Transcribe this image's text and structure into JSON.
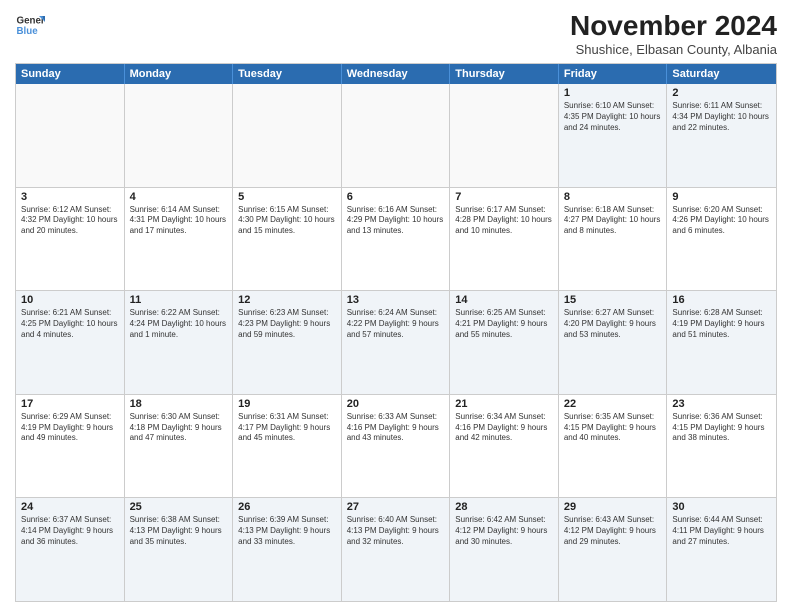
{
  "header": {
    "logo_line1": "General",
    "logo_line2": "Blue",
    "month_title": "November 2024",
    "subtitle": "Shushice, Elbasan County, Albania"
  },
  "days_of_week": [
    "Sunday",
    "Monday",
    "Tuesday",
    "Wednesday",
    "Thursday",
    "Friday",
    "Saturday"
  ],
  "weeks": [
    [
      {
        "day": "",
        "info": "",
        "empty": true
      },
      {
        "day": "",
        "info": "",
        "empty": true
      },
      {
        "day": "",
        "info": "",
        "empty": true
      },
      {
        "day": "",
        "info": "",
        "empty": true
      },
      {
        "day": "",
        "info": "",
        "empty": true
      },
      {
        "day": "1",
        "info": "Sunrise: 6:10 AM\nSunset: 4:35 PM\nDaylight: 10 hours and 24 minutes."
      },
      {
        "day": "2",
        "info": "Sunrise: 6:11 AM\nSunset: 4:34 PM\nDaylight: 10 hours and 22 minutes."
      }
    ],
    [
      {
        "day": "3",
        "info": "Sunrise: 6:12 AM\nSunset: 4:32 PM\nDaylight: 10 hours and 20 minutes."
      },
      {
        "day": "4",
        "info": "Sunrise: 6:14 AM\nSunset: 4:31 PM\nDaylight: 10 hours and 17 minutes."
      },
      {
        "day": "5",
        "info": "Sunrise: 6:15 AM\nSunset: 4:30 PM\nDaylight: 10 hours and 15 minutes."
      },
      {
        "day": "6",
        "info": "Sunrise: 6:16 AM\nSunset: 4:29 PM\nDaylight: 10 hours and 13 minutes."
      },
      {
        "day": "7",
        "info": "Sunrise: 6:17 AM\nSunset: 4:28 PM\nDaylight: 10 hours and 10 minutes."
      },
      {
        "day": "8",
        "info": "Sunrise: 6:18 AM\nSunset: 4:27 PM\nDaylight: 10 hours and 8 minutes."
      },
      {
        "day": "9",
        "info": "Sunrise: 6:20 AM\nSunset: 4:26 PM\nDaylight: 10 hours and 6 minutes."
      }
    ],
    [
      {
        "day": "10",
        "info": "Sunrise: 6:21 AM\nSunset: 4:25 PM\nDaylight: 10 hours and 4 minutes."
      },
      {
        "day": "11",
        "info": "Sunrise: 6:22 AM\nSunset: 4:24 PM\nDaylight: 10 hours and 1 minute."
      },
      {
        "day": "12",
        "info": "Sunrise: 6:23 AM\nSunset: 4:23 PM\nDaylight: 9 hours and 59 minutes."
      },
      {
        "day": "13",
        "info": "Sunrise: 6:24 AM\nSunset: 4:22 PM\nDaylight: 9 hours and 57 minutes."
      },
      {
        "day": "14",
        "info": "Sunrise: 6:25 AM\nSunset: 4:21 PM\nDaylight: 9 hours and 55 minutes."
      },
      {
        "day": "15",
        "info": "Sunrise: 6:27 AM\nSunset: 4:20 PM\nDaylight: 9 hours and 53 minutes."
      },
      {
        "day": "16",
        "info": "Sunrise: 6:28 AM\nSunset: 4:19 PM\nDaylight: 9 hours and 51 minutes."
      }
    ],
    [
      {
        "day": "17",
        "info": "Sunrise: 6:29 AM\nSunset: 4:19 PM\nDaylight: 9 hours and 49 minutes."
      },
      {
        "day": "18",
        "info": "Sunrise: 6:30 AM\nSunset: 4:18 PM\nDaylight: 9 hours and 47 minutes."
      },
      {
        "day": "19",
        "info": "Sunrise: 6:31 AM\nSunset: 4:17 PM\nDaylight: 9 hours and 45 minutes."
      },
      {
        "day": "20",
        "info": "Sunrise: 6:33 AM\nSunset: 4:16 PM\nDaylight: 9 hours and 43 minutes."
      },
      {
        "day": "21",
        "info": "Sunrise: 6:34 AM\nSunset: 4:16 PM\nDaylight: 9 hours and 42 minutes."
      },
      {
        "day": "22",
        "info": "Sunrise: 6:35 AM\nSunset: 4:15 PM\nDaylight: 9 hours and 40 minutes."
      },
      {
        "day": "23",
        "info": "Sunrise: 6:36 AM\nSunset: 4:15 PM\nDaylight: 9 hours and 38 minutes."
      }
    ],
    [
      {
        "day": "24",
        "info": "Sunrise: 6:37 AM\nSunset: 4:14 PM\nDaylight: 9 hours and 36 minutes."
      },
      {
        "day": "25",
        "info": "Sunrise: 6:38 AM\nSunset: 4:13 PM\nDaylight: 9 hours and 35 minutes."
      },
      {
        "day": "26",
        "info": "Sunrise: 6:39 AM\nSunset: 4:13 PM\nDaylight: 9 hours and 33 minutes."
      },
      {
        "day": "27",
        "info": "Sunrise: 6:40 AM\nSunset: 4:13 PM\nDaylight: 9 hours and 32 minutes."
      },
      {
        "day": "28",
        "info": "Sunrise: 6:42 AM\nSunset: 4:12 PM\nDaylight: 9 hours and 30 minutes."
      },
      {
        "day": "29",
        "info": "Sunrise: 6:43 AM\nSunset: 4:12 PM\nDaylight: 9 hours and 29 minutes."
      },
      {
        "day": "30",
        "info": "Sunrise: 6:44 AM\nSunset: 4:11 PM\nDaylight: 9 hours and 27 minutes."
      }
    ]
  ]
}
